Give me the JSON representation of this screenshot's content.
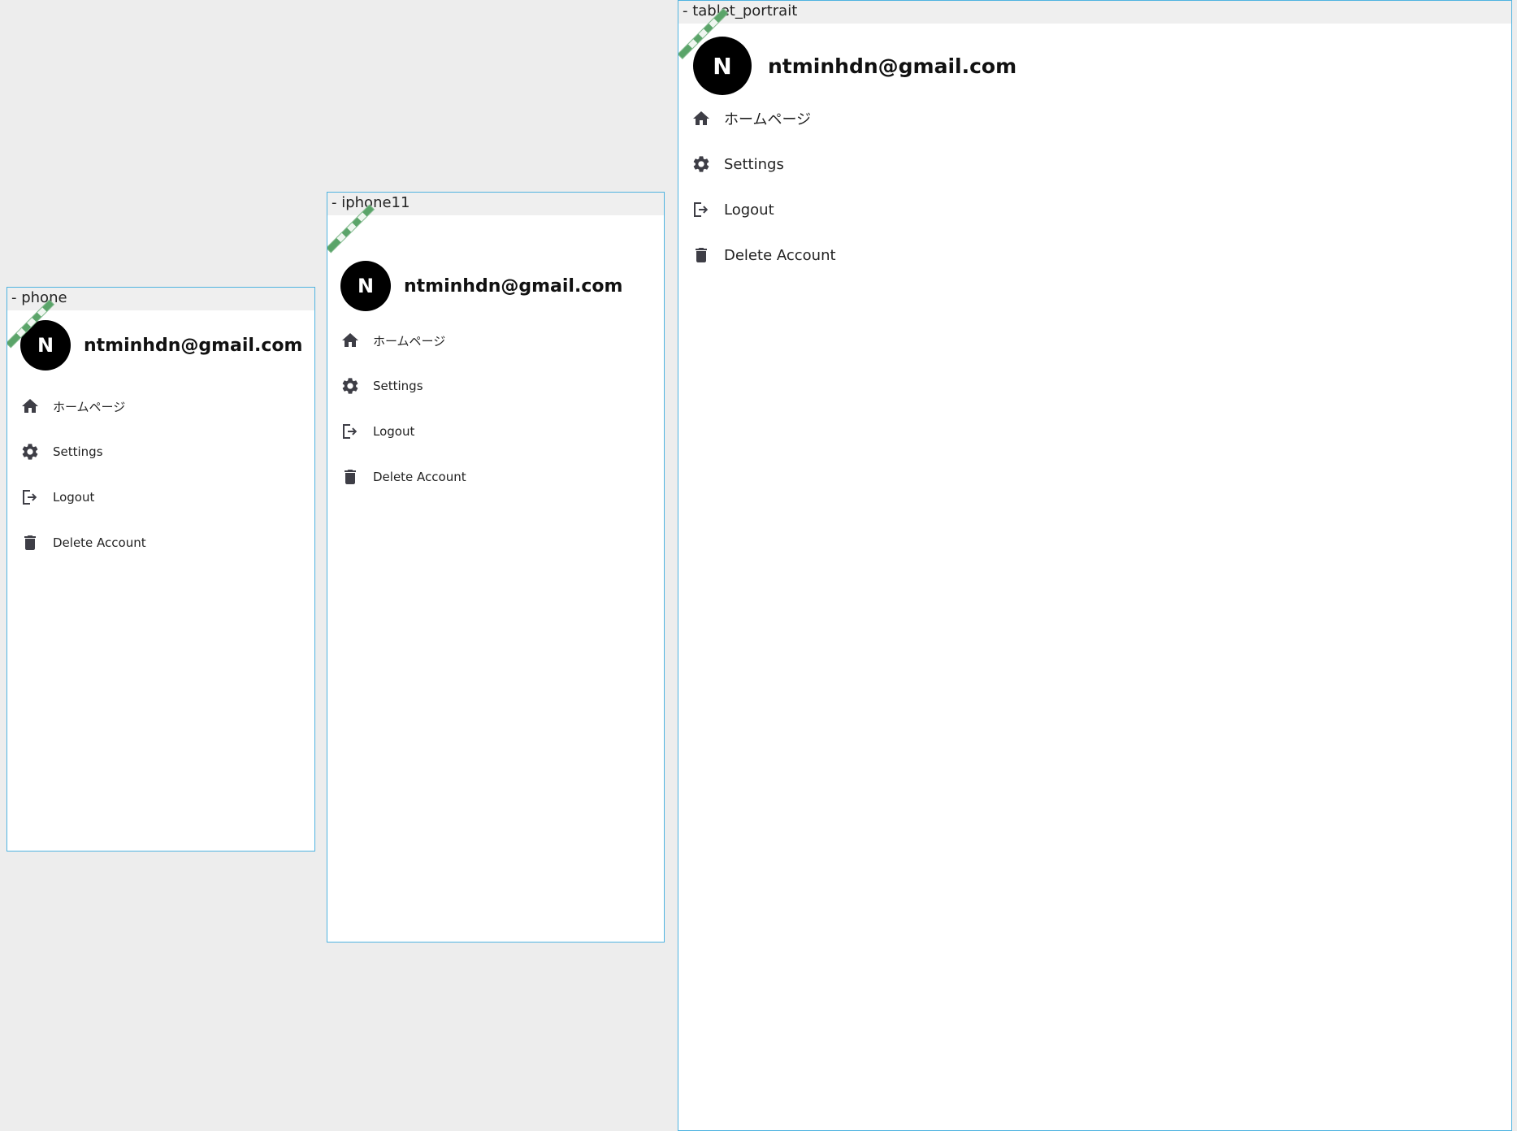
{
  "canvas": {
    "background": "#ededed",
    "frame_border_color": "#4fb3e0"
  },
  "frames": [
    {
      "label": "- phone",
      "user": {
        "avatar_letter": "N",
        "email": "ntminhdn@gmail.com"
      },
      "menu": [
        {
          "icon": "home-icon",
          "label": "ホームページ"
        },
        {
          "icon": "gear-icon",
          "label": "Settings"
        },
        {
          "icon": "logout-icon",
          "label": "Logout"
        },
        {
          "icon": "trash-icon",
          "label": "Delete Account"
        }
      ]
    },
    {
      "label": "- iphone11",
      "user": {
        "avatar_letter": "N",
        "email": "ntminhdn@gmail.com"
      },
      "menu": [
        {
          "icon": "home-icon",
          "label": "ホームページ"
        },
        {
          "icon": "gear-icon",
          "label": "Settings"
        },
        {
          "icon": "logout-icon",
          "label": "Logout"
        },
        {
          "icon": "trash-icon",
          "label": "Delete Account"
        }
      ]
    },
    {
      "label": "- tablet_portrait",
      "user": {
        "avatar_letter": "N",
        "email": "ntminhdn@gmail.com"
      },
      "menu": [
        {
          "icon": "home-icon",
          "label": "ホームページ"
        },
        {
          "icon": "gear-icon",
          "label": "Settings"
        },
        {
          "icon": "logout-icon",
          "label": "Logout"
        },
        {
          "icon": "trash-icon",
          "label": "Delete Account"
        }
      ]
    }
  ],
  "colors": {
    "avatar_bg": "#000000",
    "avatar_text": "#ffffff",
    "icon": "#3e3e46",
    "debug_banner": "#5aa469"
  }
}
